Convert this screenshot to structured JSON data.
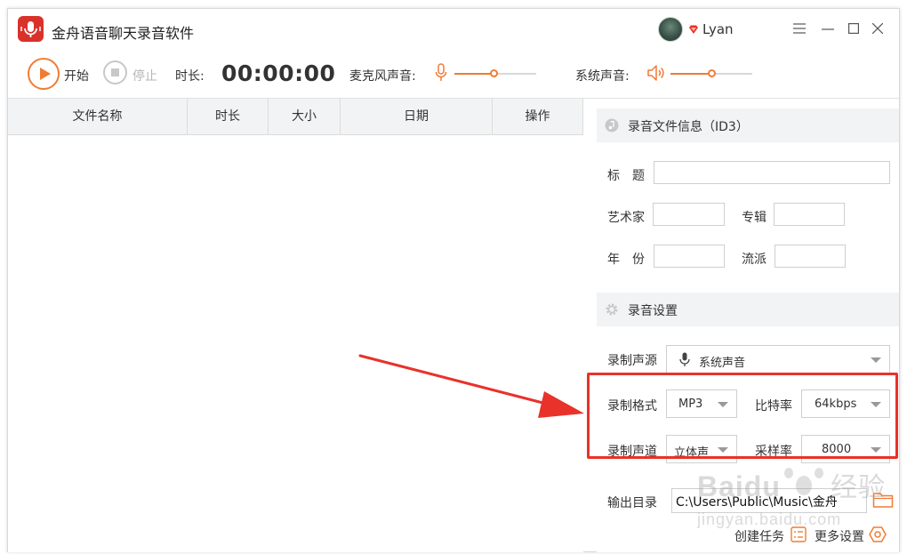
{
  "app": {
    "title": "金舟语音聊天录音软件"
  },
  "user": {
    "name": "Lyan"
  },
  "toolbar": {
    "start_label": "开始",
    "stop_label": "停止",
    "duration_label": "时长:",
    "duration_value": "00:00:00",
    "mic_label": "麦克风声音:",
    "mic_level": 0.48,
    "system_label": "系统声音:",
    "system_level": 0.5
  },
  "table": {
    "columns": [
      "文件名称",
      "时长",
      "大小",
      "日期",
      "操作"
    ],
    "rows": []
  },
  "id3": {
    "section_title": "录音文件信息（ID3）",
    "title_label": "标　题",
    "artist_label": "艺术家",
    "album_label": "专辑",
    "year_label": "年　份",
    "genre_label": "流派",
    "title_value": "",
    "artist_value": "",
    "album_value": "",
    "year_value": "",
    "genre_value": ""
  },
  "settings": {
    "section_title": "录音设置",
    "source_label": "录制声源",
    "source_value": "系统声音",
    "format_label": "录制格式",
    "format_value": "MP3",
    "bitrate_label": "比特率",
    "bitrate_value": "64kbps",
    "channel_label": "录制声道",
    "channel_value": "立体声",
    "samplerate_label": "采样率",
    "samplerate_value": "8000",
    "output_label": "输出目录",
    "output_value": "C:\\Users\\Public\\Music\\金舟",
    "create_task_label": "创建任务",
    "more_settings_label": "更多设置"
  },
  "colors": {
    "accent": "#f07c34",
    "annotation": "#e8322a",
    "app_icon": "#d9322a",
    "header_bg": "#f2f3f5"
  },
  "watermark": {
    "text": "Baidu 经验",
    "subtext": "jingyan.baidu.com"
  }
}
